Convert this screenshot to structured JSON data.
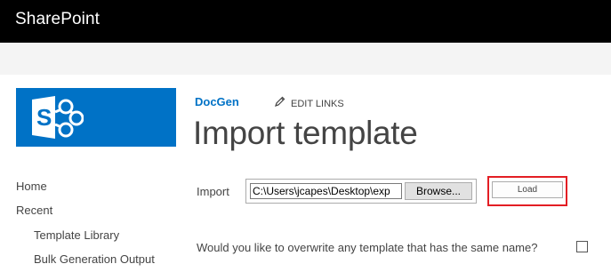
{
  "suite_bar": {
    "brand": "SharePoint"
  },
  "site": {
    "title": "DocGen",
    "edit_links_label": "EDIT LINKS"
  },
  "page": {
    "title": "Import template"
  },
  "quick_launch": {
    "items": [
      {
        "label": "Home"
      },
      {
        "label": "Recent"
      },
      {
        "label": "Template Library"
      },
      {
        "label": "Bulk Generation Output"
      }
    ]
  },
  "form": {
    "import_label": "Import",
    "file_path_value": "C:\\Users\\jcapes\\Desktop\\exp",
    "browse_label": "Browse...",
    "load_label": "Load",
    "overwrite_question": "Would you like to overwrite any template that has the same name?",
    "overwrite_checked": false
  },
  "colors": {
    "suite_bar": "#000000",
    "accent": "#0072c6",
    "highlight": "#e31e24"
  },
  "icons": {
    "logo": "sharepoint-logo-icon",
    "edit": "pencil-icon"
  }
}
